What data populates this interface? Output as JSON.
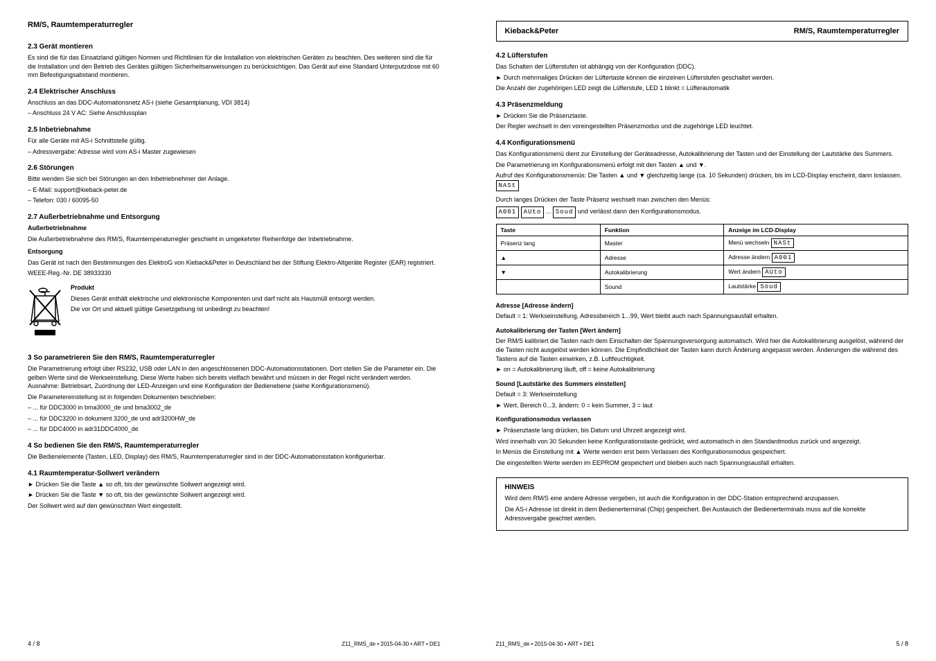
{
  "left_page": {
    "header": "RM/S, Raumtemperaturregler",
    "section1": {
      "title": "2.3 Gerät montieren",
      "text": "Es sind die für das Einsatzland gültigen Normen und Richtlinien für die Installation von elektrischen Geräten zu beachten. Des weiteren sind die für die Installation und den Betrieb des Gerätes gültigen Sicherheitsanweisungen zu berücksichtigen. Das Gerät auf eine Standard Unterputzdose mit 60 mm Befestigungsabstand montieren."
    },
    "section2": {
      "title": "2.4 Elektrischer Anschluss",
      "line1": "Anschluss an das DDC-Automationsnetz AS-i (siehe Gesamtplanung, VDI 3814)",
      "line2": "– Anschluss 24 V AC: Siehe Anschlussplan"
    },
    "section3": {
      "title": "2.5 Inbetriebnahme",
      "line1": "Für alle Geräte mit AS-i Schnittstelle gültig.",
      "line2": "– Adressvergabe: Adresse wird vom AS-i Master zugewiesen"
    },
    "section4": {
      "title": "2.6 Störungen",
      "line1": "Bitte wenden Sie sich bei Störungen an den Inbetriebnehmer der Anlage.",
      "line2": "– E-Mail: support@kieback-peter.de",
      "line3": "– Telefon: 030 / 60095-50"
    },
    "section5": {
      "title": "2.7 Außerbetriebnahme und Entsorgung",
      "subtitle1": "Außerbetriebnahme",
      "text1": "Die Außerbetriebnahme des RM/S, Raumtemperaturregler geschieht in umgekehrter Reihenfolge der Inbetriebnahme.",
      "subtitle2": "Entsorgung",
      "text2a": "Das Gerät ist nach den Bestimmungen des ElektroG von Kieback&Peter in Deutschland bei der Stiftung Elektro-Altgeräte Register (EAR) registriert.",
      "text2b": "WEEE-Reg.-Nr. DE 38933330",
      "subtitle3": "Produkt",
      "text3a": "Dieses Gerät enthält elektrische und elektronische Komponenten und darf nicht als Hausmüll entsorgt werden.",
      "text3b": "Die vor Ort und aktuell gültige Gesetzgebung ist unbedingt zu beachten!"
    },
    "section6": {
      "title": "3 So parametrieren Sie den RM/S, Raumtemperaturregler",
      "text1": "Die Parametrierung erfolgt über RS232, USB oder LAN in den angeschlossenen DDC-Automationsstationen. Dort stellen Sie die Parameter ein. Die gelben Werte sind die Werkseinstellung. Diese Werte haben sich bereits vielfach bewährt und müssen in der Regel nicht verändert werden. Ausnahme: Betriebsart, Zuordnung der LED-Anzeigen und eine Konfiguration der Bedienebene (siehe Konfigurationsmenü).",
      "text2": "Die Parametereinstellung ist in folgenden Dokumenten beschrieben:",
      "bullets": [
        "– ... für DDC3000 in bma3000_de und bma3002_de",
        "– ... für DDC3200 in dokument 3200_de und adr3200HW_de",
        "– ... für DDC4000 in adr31DDC4000_de"
      ]
    },
    "section7": {
      "title": "4 So bedienen Sie den RM/S, Raumtemperaturregler",
      "text": "Die Bedienelemente (Tasten, LED, Display) des RM/S, Raumtemperaturregler sind in der DDC-Automationsstation konfigurierbar."
    },
    "section8": {
      "title": "4.1 Raumtemperatur-Sollwert verändern",
      "bullets": [
        "► Drücken Sie die Taste ▲ so oft, bis der gewünschte Sollwert angezeigt wird.",
        "► Drücken Sie die Taste ▼ so oft, bis der gewünschte Sollwert angezeigt wird.",
        "Der Sollwert wird auf den gewünschten Wert eingestellt."
      ]
    },
    "page_num": "4 / 8",
    "doc_ref": "Z11_RMS_de • 2015-04-30 • ART • DE1"
  },
  "right_page": {
    "header_left": "Kieback&Peter",
    "header_right": "RM/S, Raumtemperaturregler",
    "section1": {
      "title": "4.2 Lüfterstufen",
      "text": "Das Schalten der Lüfterstufen ist abhängig von der Konfiguration (DDC).",
      "bullets": [
        "► Durch mehrmaliges Drücken der Lüftertaste können die einzelnen Lüfterstufen geschaltet werden.",
        "Die Anzahl der zugehörigen LED zeigt die Lüfterstufe, LED 1 blinkt = Lüfterautomatik"
      ]
    },
    "section2": {
      "title": "4.3 Präsenzmeldung",
      "bullets": [
        "► Drücken Sie die Präsenztaste.",
        "Der Regler wechselt in den voreingestellten Präsenzmodus und die zugehörige LED leuchtet."
      ]
    },
    "section3": {
      "title": "4.4 Konfigurationsmenü",
      "text1": "Das Konfigurationsmenü dient zur Einstellung der Geräteadresse, Autokalibrierung der Tasten und der Einstellung der Lautstärke des Summers.",
      "text2": "Die Parametrierung im Konfigurationsmenü erfolgt mit den Tasten ▲ und ▼.",
      "text3": "Aufruf des Konfigurationsmenüs: Die Tasten ▲ und ▼ gleichzeitig lange (ca. 10 Sekunden) drücken, bis im LCD-Display erscheint, dann loslassen.",
      "mast_display": "NASt",
      "text4": "Durch langes Drücken der Taste Präsenz wechselt man zwischen den Menüs:",
      "displays": [
        "A001",
        "AUto",
        "Soud"
      ],
      "text5": "und verlässt dann den Konfigurationsmodus."
    },
    "table": {
      "headers": [
        "Taste",
        "Funktion",
        "Anzeige im LCD-Display"
      ],
      "rows": [
        {
          "col1": "Präsenz lang",
          "col2": "Master",
          "col3_text": "Menü wechseln ",
          "col3_display": "NASt"
        },
        {
          "col1": "▲",
          "col2": "Adresse",
          "col3_text": "Adresse ändern ",
          "col3_display": "A001"
        },
        {
          "col1": "▼",
          "col2": "Autokalibrierung",
          "col3_text": "Wert ändern ",
          "col3_display": "AUto"
        },
        {
          "col1": "",
          "col2": "Sound",
          "col3_text": "Lautstärke ",
          "col3_display": "Soud"
        }
      ]
    },
    "subsection1": {
      "title": "Adresse [Adresse ändern]",
      "text": "Default = 1: Werkseinstellung, Adressbereich 1...99, Wert bleibt auch nach Spannungsausfall erhalten."
    },
    "subsection2": {
      "title": "Autokalibrierung der Tasten [Wert ändern]",
      "text1": "Der RM/S kalibriert die Tasten nach dem Einschalten der Spannungsversorgung automatisch. Wird hier die Autokalibrierung ausgelöst, während der die Tasten nicht ausgelöst werden können. Die Empfindlichkeit der Tasten kann durch Änderung angepasst werden. Änderungen die während des Tastens auf die Tasten einwirken, z.B. Luftfeuchtigkeit.",
      "text2": "► on = Autokalibrierung läuft, off = keine Autokalibrierung"
    },
    "subsection3": {
      "title": "Sound [Lautstärke des Summers einstellen]",
      "text1": "Default = 3: Werkseinstellung",
      "text2": "► Wert, Bereich 0...3, ändern: 0 = kein Summer, 3 = laut"
    },
    "subsection4": {
      "title": "Konfigurationsmodus verlassen",
      "text1": "► Präsenztaste lang drücken, bis Datum und Uhrzeit angezeigt wird.",
      "text2": "Wird innerhalb von 30 Sekunden keine Konfigurationstaste gedrückt, wird automatisch in den Standardmodus zurück und angezeigt.",
      "text3": "In Menüs die Einstellung mit ▲ Werte werden erst beim Verlassen des Konfigurationsmodus gespeichert.",
      "text4": "Die eingestellten Werte werden im EEPROM gespeichert und bleiben auch nach Spannungsausfall erhalten."
    },
    "note_box": {
      "title": "HINWEIS",
      "line1": "Wird dem RM/S eine andere Adresse vergeben, ist auch die Konfiguration in der DDC-Station entsprechend anzupassen.",
      "line2": "Die AS-i Adresse ist direkt in dem Bedienerterminal (Chip) gespeichert. Bei Austausch der Bedienerterminals muss auf die korrekte Adressvergabe geachtet werden."
    },
    "page_num": "5 / 8",
    "doc_ref": "Z11_RMS_de • 2015-04-30 • ART • DE1"
  }
}
